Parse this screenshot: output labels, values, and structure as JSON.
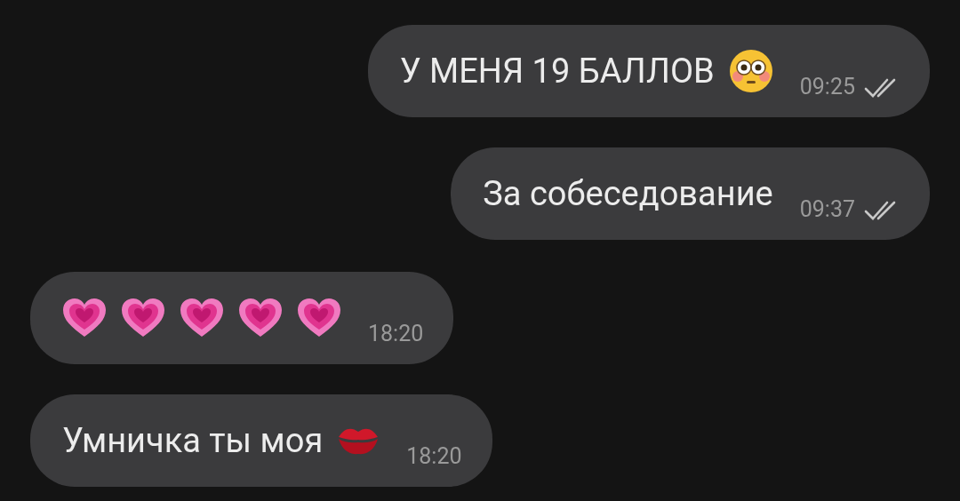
{
  "messages": [
    {
      "outgoing": true,
      "parts": [
        {
          "kind": "text",
          "text": "У МЕНЯ 19 БАЛЛОВ"
        },
        {
          "kind": "flushed"
        }
      ],
      "time": "09:25",
      "read": true
    },
    {
      "outgoing": true,
      "parts": [
        {
          "kind": "text",
          "text": "За собеседование"
        }
      ],
      "time": "09:37",
      "read": true
    },
    {
      "outgoing": false,
      "parts": [
        {
          "kind": "heart"
        },
        {
          "kind": "heart"
        },
        {
          "kind": "heart"
        },
        {
          "kind": "heart"
        },
        {
          "kind": "heart"
        }
      ],
      "time": "18:20",
      "read": false
    },
    {
      "outgoing": false,
      "parts": [
        {
          "kind": "text",
          "text": "Умничка ты моя"
        },
        {
          "kind": "lips"
        }
      ],
      "time": "18:20",
      "read": false
    }
  ]
}
